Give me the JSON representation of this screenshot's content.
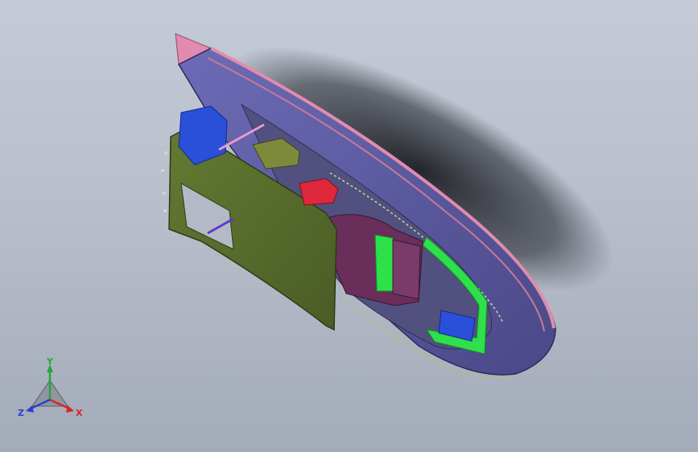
{
  "viewport": {
    "background_top": "#c4cbd6",
    "background_bottom": "#a4abb8"
  },
  "model": {
    "hull_color": "#5c5aa0",
    "deck_color": "#51507e",
    "rail_color": "#e28bb0",
    "cowling_color": "#566b2c",
    "seat_color": "#6a2e5a",
    "handle_color": "#2ee04a",
    "pad_color": "#2a4fd8",
    "accent_red": "#e0283c"
  },
  "triad": {
    "y_label": "Y",
    "x_label": "X",
    "z_label": "Z",
    "y_color": "#23a83a",
    "x_color": "#d6252b",
    "z_color": "#2a3fd0"
  }
}
